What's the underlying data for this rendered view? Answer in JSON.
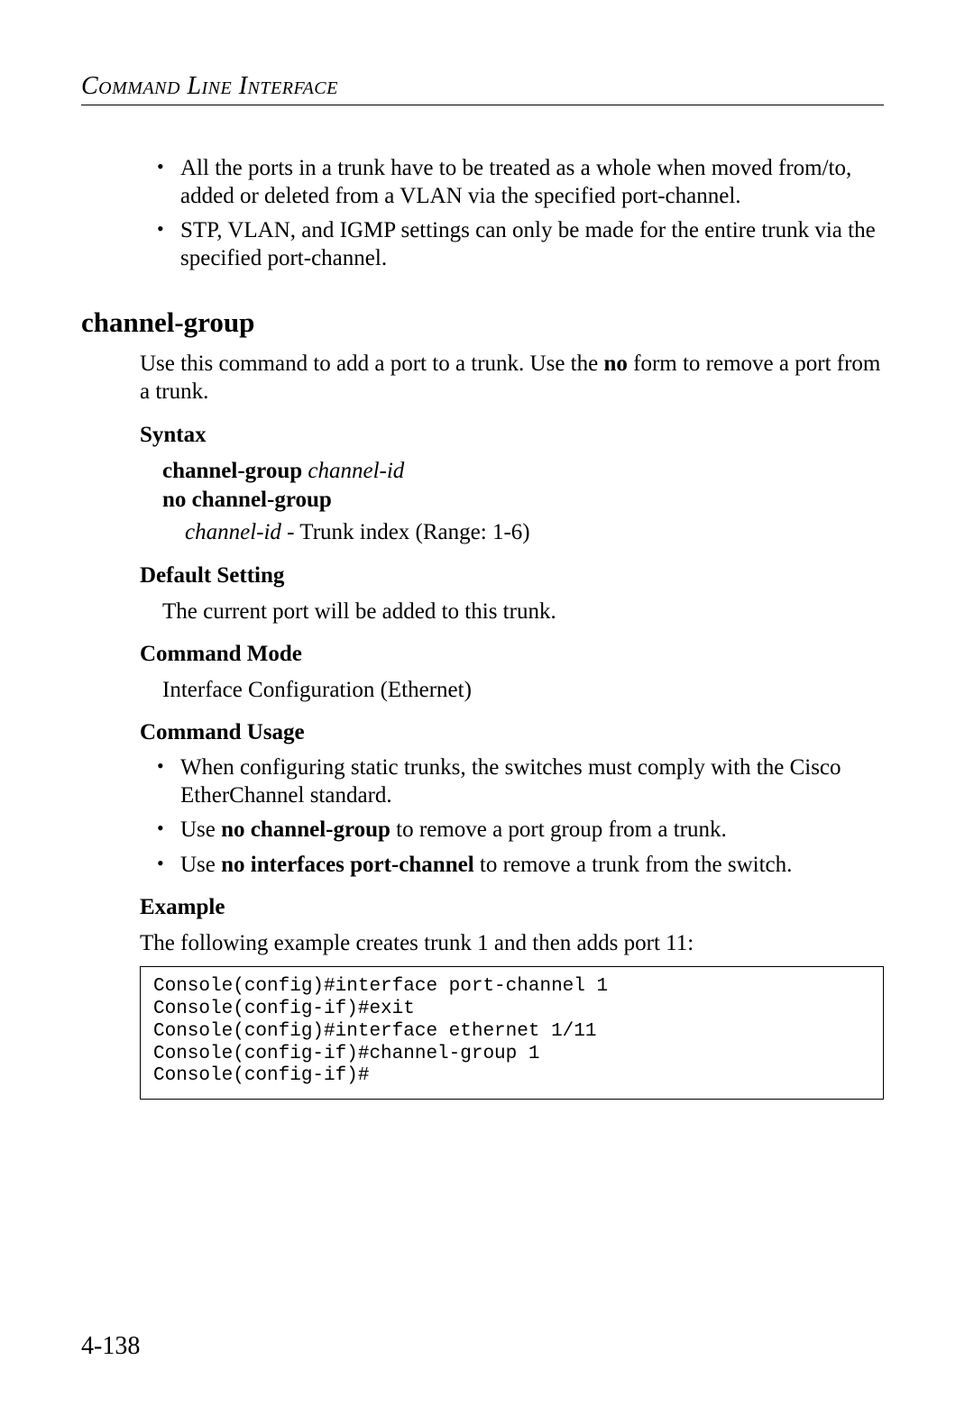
{
  "header": "Command Line Interface",
  "top_bullets": [
    "All the ports in a trunk have to be treated as a whole when moved from/to, added or deleted from a VLAN via the specified port-channel.",
    "STP, VLAN, and IGMP settings can only be made for the entire trunk via the specified port-channel."
  ],
  "command": {
    "title": "channel-group",
    "intro_pre": "Use this command to add a port to a trunk. Use the ",
    "intro_bold": "no",
    "intro_post": " form to remove a port from a trunk.",
    "syntax": {
      "head": "Syntax",
      "line1_bold": "channel-group",
      "line1_italic": "channel-id",
      "line2_bold": "no channel-group",
      "param_italic": "channel-id",
      "param_desc": " - Trunk index (Range: 1-6)"
    },
    "default": {
      "head": "Default Setting",
      "text": "The current port will be added to this trunk."
    },
    "mode": {
      "head": "Command Mode",
      "text": "Interface Configuration (Ethernet)"
    },
    "usage": {
      "head": "Command Usage",
      "items": [
        {
          "pre": "When configuring static trunks, the switches must comply with the Cisco EtherChannel standard.",
          "bold": "",
          "post": ""
        },
        {
          "pre": "Use ",
          "bold": "no channel-group",
          "post": " to remove a port group from a trunk."
        },
        {
          "pre": "Use ",
          "bold": "no interfaces port-channel",
          "post": " to remove a trunk from the switch."
        }
      ]
    },
    "example": {
      "head": "Example",
      "text": "The following example creates trunk 1 and then adds port 11:",
      "code": "Console(config)#interface port-channel 1\nConsole(config-if)#exit\nConsole(config)#interface ethernet 1/11\nConsole(config-if)#channel-group 1\nConsole(config-if)#"
    }
  },
  "page_number": "4-138"
}
